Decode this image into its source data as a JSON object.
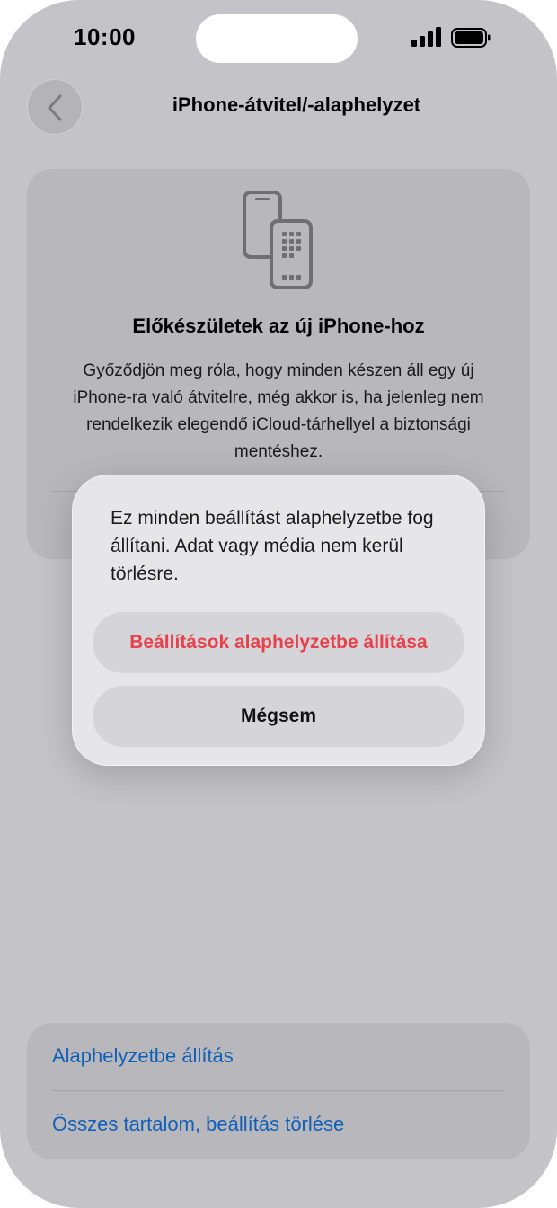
{
  "status_bar": {
    "time": "10:00",
    "signal_icon": "cellular-signal-icon",
    "battery_icon": "battery-icon"
  },
  "nav": {
    "back_icon": "chevron-left-icon",
    "title": "iPhone-átvitel/-alaphelyzet"
  },
  "prepare_card": {
    "icon": "transfer-phones-icon",
    "heading": "Előkészületek az új iPhone-hoz",
    "body": "Győződjön meg róla, hogy minden készen áll egy új iPhone-ra való átvitelre, még akkor is, ha jelenleg nem rendelkezik elegendő iCloud-tárhellyel a biztonsági mentéshez."
  },
  "dialog": {
    "message": "Ez minden beállítást alaphelyzetbe fog állítani. Adat vagy média nem kerül törlésre.",
    "reset_button": "Beállítások alaphelyzetbe állítása",
    "cancel_button": "Mégsem"
  },
  "options": {
    "reset_link": "Alaphelyzetbe állítás",
    "erase_link": "Összes tartalom, beállítás törlése"
  },
  "colors": {
    "destructive": "#e8414b",
    "link": "#1060b8",
    "dim_background": "#c3c3c8"
  }
}
